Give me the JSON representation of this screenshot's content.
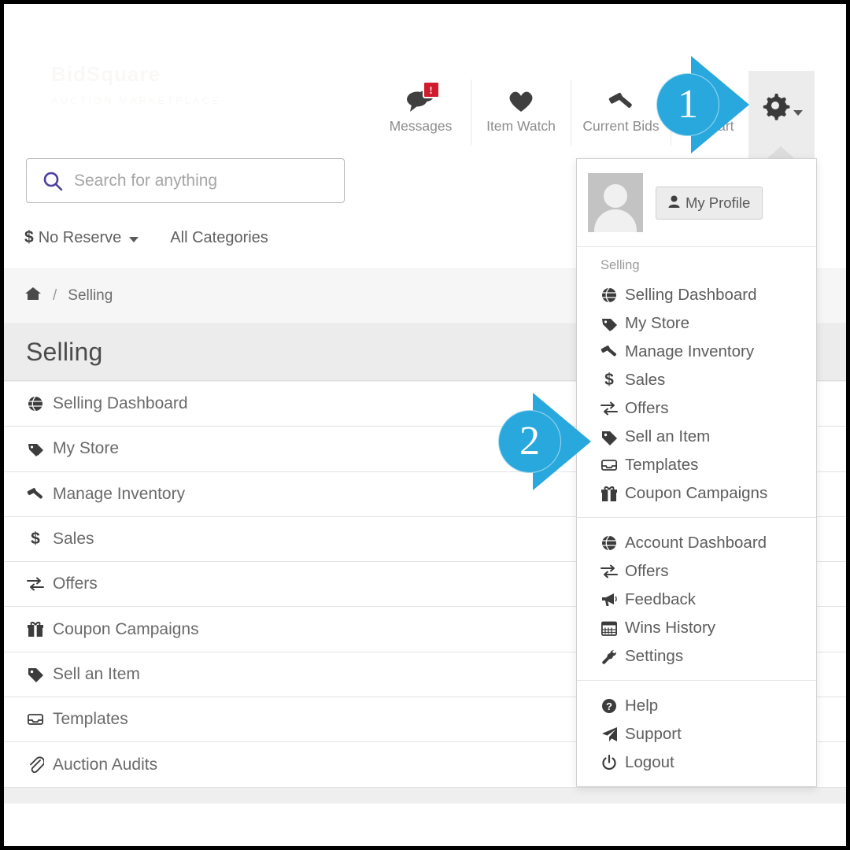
{
  "branding": {
    "logo_text": "BidSquare",
    "logo_sub": "AUCTION MARKETPLACE"
  },
  "topnav": {
    "items": [
      {
        "label": "Messages",
        "icon": "comments-icon",
        "badge": "!"
      },
      {
        "label": "Item Watch",
        "icon": "heart-icon",
        "badge": ""
      },
      {
        "label": "Current Bids",
        "icon": "gavel-icon",
        "badge": ""
      },
      {
        "label": "Cart",
        "icon": "cart-icon",
        "badge": ""
      }
    ],
    "gear": {
      "icon": "gear-icon",
      "label": "Settings Menu"
    }
  },
  "search": {
    "placeholder": "Search for anything",
    "value": "",
    "icon": "search-icon"
  },
  "filters": {
    "no_reserve": "No Reserve",
    "all_categories": "All Categories"
  },
  "breadcrumb": {
    "home_icon": "home-icon",
    "separator": "/",
    "current": "Selling"
  },
  "page": {
    "title": "Selling"
  },
  "selling_list": [
    {
      "label": "Selling Dashboard",
      "icon": "globe-icon"
    },
    {
      "label": "My Store",
      "icon": "tags-icon"
    },
    {
      "label": "Manage Inventory",
      "icon": "gavel-icon"
    },
    {
      "label": "Sales",
      "icon": "dollar-icon"
    },
    {
      "label": "Offers",
      "icon": "exchange-icon"
    },
    {
      "label": "Coupon Campaigns",
      "icon": "gift-icon"
    },
    {
      "label": "Sell an Item",
      "icon": "tag-icon"
    },
    {
      "label": "Templates",
      "icon": "inbox-icon"
    },
    {
      "label": "Auction Audits",
      "icon": "paperclip-icon"
    }
  ],
  "dropdown": {
    "profile_button": {
      "label": "My Profile",
      "icon": "user-icon"
    },
    "avatar": "default-avatar",
    "selling_heading": "Selling",
    "selling_items": [
      {
        "label": "Selling Dashboard",
        "icon": "globe-icon"
      },
      {
        "label": "My Store",
        "icon": "tags-icon"
      },
      {
        "label": "Manage Inventory",
        "icon": "gavel-icon"
      },
      {
        "label": "Sales",
        "icon": "dollar-icon"
      },
      {
        "label": "Offers",
        "icon": "exchange-icon"
      },
      {
        "label": "Sell an Item",
        "icon": "tag-icon"
      },
      {
        "label": "Templates",
        "icon": "inbox-icon"
      },
      {
        "label": "Coupon Campaigns",
        "icon": "gift-icon"
      }
    ],
    "account_items": [
      {
        "label": "Account Dashboard",
        "icon": "globe-icon"
      },
      {
        "label": "Offers",
        "icon": "exchange-icon"
      },
      {
        "label": "Feedback",
        "icon": "bullhorn-icon"
      },
      {
        "label": "Wins History",
        "icon": "calendar-icon"
      },
      {
        "label": "Settings",
        "icon": "wrench-icon"
      }
    ],
    "support_items": [
      {
        "label": "Help",
        "icon": "question-circle-icon"
      },
      {
        "label": "Support",
        "icon": "paper-plane-icon"
      },
      {
        "label": "Logout",
        "icon": "power-off-icon"
      }
    ]
  },
  "annotations": [
    {
      "number": "1",
      "color": "#29a8dd",
      "points_to": "gear-icon"
    },
    {
      "number": "2",
      "color": "#29a8dd",
      "points_to": "dropdown-sell-an-item"
    }
  ]
}
